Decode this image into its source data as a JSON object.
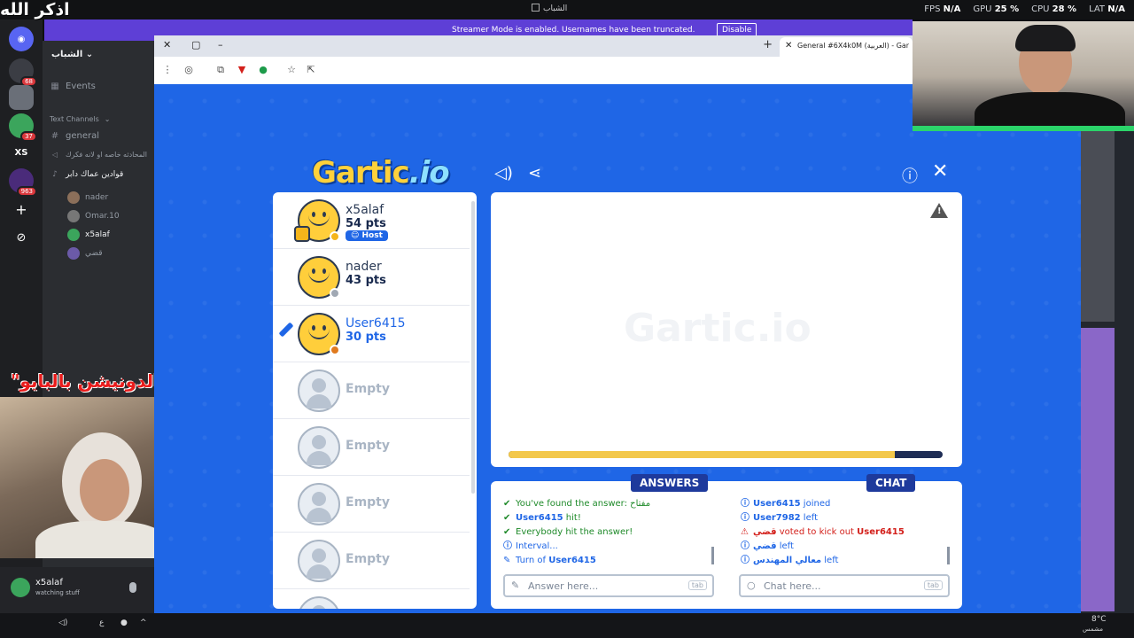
{
  "overlay": {
    "top_arabic": "اذكر الله",
    "donation_text": "\"رابط الدونيشن بالبايو\""
  },
  "system": {
    "window_title": "الشباب",
    "stats": [
      {
        "label": "FPS",
        "value": "N/A"
      },
      {
        "label": "GPU",
        "value": "25 %"
      },
      {
        "label": "CPU",
        "value": "28 %"
      },
      {
        "label": "LAT",
        "value": "N/A"
      }
    ]
  },
  "banner": {
    "message": "Streamer Mode is enabled. Usernames have been truncated.",
    "disable_label": "Disable"
  },
  "discord": {
    "servers": [
      {
        "badge": "68"
      },
      {
        "badge": ""
      },
      {
        "badge": "37"
      },
      {
        "label": "XS",
        "badge": ""
      },
      {
        "badge": "963"
      }
    ],
    "server_name": "الشباب",
    "events_label": "Events",
    "text_channels_label": "Text Channels",
    "channels": [
      "general",
      "المحادثه خاصه او لانه فكرك"
    ],
    "voice_channel": "قوادين عماك دابر",
    "voice_users": [
      "nader",
      "Omar.10",
      "x5alaf",
      "قضي"
    ],
    "user_panel": {
      "name": "x5alaf",
      "status": "watching stuff"
    }
  },
  "browser": {
    "tab_title": "General #6X4k0M (العربية) - Gar",
    "new_tab": "+"
  },
  "game": {
    "logo_main": "Gartic",
    "logo_suffix": ".io",
    "players": [
      {
        "name": "x5alaf",
        "points": "54 pts",
        "host_label": "Host",
        "dot_color": "#f5b51b"
      },
      {
        "name": "nader",
        "points": "43 pts",
        "dot_color": "#a0a8b3"
      },
      {
        "name": "User6415",
        "points": "30 pts",
        "dot_color": "#e07a1e"
      },
      {
        "name": "Empty"
      },
      {
        "name": "Empty"
      },
      {
        "name": "Empty"
      },
      {
        "name": "Empty"
      }
    ],
    "canvas_watermark": "Gartic.io",
    "timer_progress": 0.89,
    "answers": {
      "tab_label": "ANSWERS",
      "messages": [
        {
          "icon": "check",
          "text": "You've found the answer: ",
          "tail": "مفتاح"
        },
        {
          "icon": "check",
          "user": "User6415",
          "text": " hit!"
        },
        {
          "icon": "check",
          "text": "Everybody hit the answer!"
        },
        {
          "icon": "info",
          "text": "Interval..."
        },
        {
          "icon": "pencil",
          "text": "Turn of ",
          "user": "User6415"
        }
      ],
      "placeholder": "Answer here...",
      "tab_hint": "tab"
    },
    "chat": {
      "tab_label": "CHAT",
      "messages": [
        {
          "icon": "info",
          "user": "User6415",
          "text": " joined"
        },
        {
          "icon": "info",
          "user": "User7982",
          "text": " left"
        },
        {
          "icon": "warn",
          "user": "قضي",
          "text": " voted to kick out ",
          "target": "User6415"
        },
        {
          "icon": "info",
          "user": "قضي",
          "text": " left"
        },
        {
          "icon": "info",
          "user": "معالي المهندس",
          "text": " left"
        }
      ],
      "placeholder": "Chat here...",
      "tab_hint": "tab"
    }
  },
  "taskbar": {
    "weather": "8°C",
    "weather_label": "مشمس"
  }
}
